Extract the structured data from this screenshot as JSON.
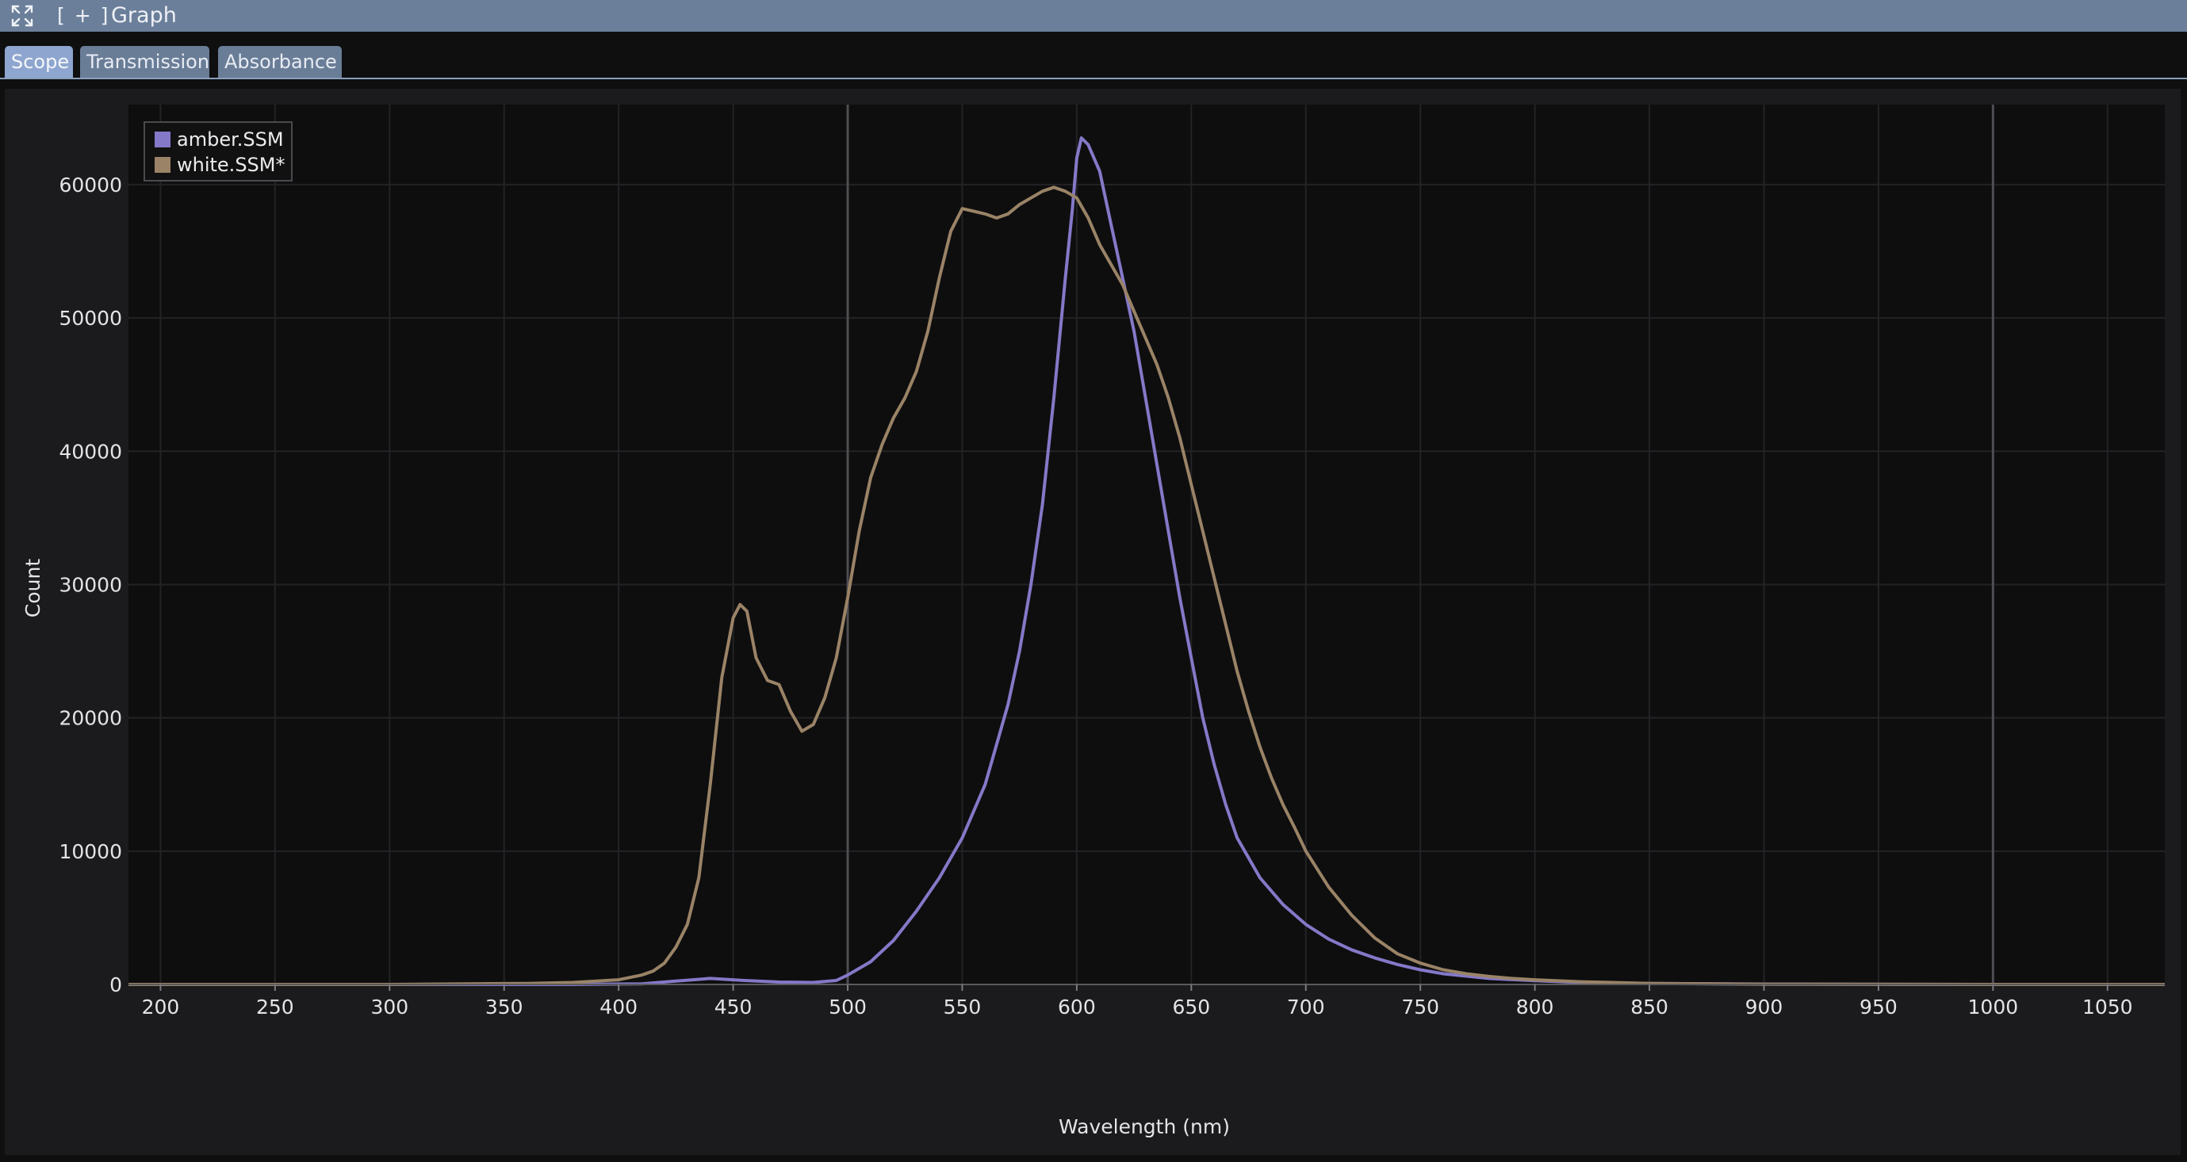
{
  "window": {
    "add_label": "[ + ]",
    "title": "Graph"
  },
  "tabs": [
    {
      "label": "Scope",
      "active": true
    },
    {
      "label": "Transmission",
      "active": false
    },
    {
      "label": "Absorbance",
      "active": false
    }
  ],
  "colors": {
    "titlebar": "#6b7f9a",
    "active_tab": "#8ea6cf",
    "plot_background": "#0e0e0f",
    "amber_series": "#8479c8",
    "white_series": "#9a8366"
  },
  "chart_data": {
    "type": "line",
    "title": "",
    "xlabel": "Wavelength (nm)",
    "ylabel": "Count",
    "xlim": [
      186,
      1075
    ],
    "ylim": [
      0,
      66000
    ],
    "xticks": [
      200,
      250,
      300,
      350,
      400,
      450,
      500,
      550,
      600,
      650,
      700,
      750,
      800,
      850,
      900,
      950,
      1000,
      1050
    ],
    "yticks": [
      0,
      10000,
      20000,
      30000,
      40000,
      50000,
      60000
    ],
    "marker_lines_x": [
      500,
      1000
    ],
    "grid": true,
    "legend_position": "top-left",
    "series": [
      {
        "name": "amber.SSM",
        "color": "#8479c8",
        "points": [
          [
            186,
            0
          ],
          [
            300,
            0
          ],
          [
            380,
            0
          ],
          [
            410,
            50
          ],
          [
            425,
            250
          ],
          [
            440,
            450
          ],
          [
            455,
            300
          ],
          [
            470,
            180
          ],
          [
            485,
            150
          ],
          [
            495,
            300
          ],
          [
            500,
            700
          ],
          [
            510,
            1700
          ],
          [
            520,
            3300
          ],
          [
            530,
            5500
          ],
          [
            540,
            8000
          ],
          [
            550,
            11000
          ],
          [
            560,
            15000
          ],
          [
            565,
            18000
          ],
          [
            570,
            21000
          ],
          [
            575,
            25000
          ],
          [
            580,
            30000
          ],
          [
            585,
            36000
          ],
          [
            590,
            44000
          ],
          [
            595,
            53000
          ],
          [
            598,
            58000
          ],
          [
            600,
            62000
          ],
          [
            602,
            63500
          ],
          [
            605,
            63000
          ],
          [
            610,
            61000
          ],
          [
            615,
            57000
          ],
          [
            620,
            53000
          ],
          [
            625,
            49000
          ],
          [
            630,
            44000
          ],
          [
            635,
            39000
          ],
          [
            640,
            34000
          ],
          [
            645,
            29000
          ],
          [
            650,
            24500
          ],
          [
            655,
            20000
          ],
          [
            660,
            16500
          ],
          [
            665,
            13500
          ],
          [
            670,
            11000
          ],
          [
            680,
            8000
          ],
          [
            690,
            6000
          ],
          [
            700,
            4500
          ],
          [
            710,
            3400
          ],
          [
            720,
            2600
          ],
          [
            730,
            2000
          ],
          [
            740,
            1500
          ],
          [
            750,
            1100
          ],
          [
            760,
            800
          ],
          [
            780,
            450
          ],
          [
            800,
            280
          ],
          [
            820,
            150
          ],
          [
            850,
            80
          ],
          [
            900,
            30
          ],
          [
            1000,
            0
          ],
          [
            1075,
            0
          ]
        ]
      },
      {
        "name": "white.SSM*",
        "color": "#9a8366",
        "points": [
          [
            186,
            0
          ],
          [
            300,
            0
          ],
          [
            360,
            80
          ],
          [
            380,
            150
          ],
          [
            400,
            350
          ],
          [
            410,
            700
          ],
          [
            415,
            1000
          ],
          [
            420,
            1600
          ],
          [
            425,
            2800
          ],
          [
            430,
            4500
          ],
          [
            435,
            8000
          ],
          [
            440,
            15000
          ],
          [
            445,
            23000
          ],
          [
            450,
            27500
          ],
          [
            453,
            28500
          ],
          [
            456,
            28000
          ],
          [
            460,
            24500
          ],
          [
            465,
            22800
          ],
          [
            470,
            22500
          ],
          [
            475,
            20500
          ],
          [
            480,
            19000
          ],
          [
            485,
            19500
          ],
          [
            490,
            21500
          ],
          [
            495,
            24500
          ],
          [
            500,
            29000
          ],
          [
            505,
            34000
          ],
          [
            510,
            38000
          ],
          [
            515,
            40500
          ],
          [
            520,
            42500
          ],
          [
            525,
            44000
          ],
          [
            530,
            46000
          ],
          [
            535,
            49000
          ],
          [
            540,
            53000
          ],
          [
            545,
            56500
          ],
          [
            550,
            58200
          ],
          [
            555,
            58000
          ],
          [
            560,
            57800
          ],
          [
            565,
            57500
          ],
          [
            570,
            57800
          ],
          [
            575,
            58500
          ],
          [
            580,
            59000
          ],
          [
            585,
            59500
          ],
          [
            590,
            59800
          ],
          [
            595,
            59500
          ],
          [
            600,
            59000
          ],
          [
            605,
            57500
          ],
          [
            610,
            55500
          ],
          [
            615,
            54000
          ],
          [
            620,
            52500
          ],
          [
            625,
            50500
          ],
          [
            630,
            48500
          ],
          [
            635,
            46500
          ],
          [
            640,
            44000
          ],
          [
            645,
            41000
          ],
          [
            650,
            37500
          ],
          [
            655,
            34000
          ],
          [
            660,
            30500
          ],
          [
            665,
            27000
          ],
          [
            670,
            23500
          ],
          [
            675,
            20500
          ],
          [
            680,
            17800
          ],
          [
            685,
            15500
          ],
          [
            690,
            13500
          ],
          [
            695,
            11800
          ],
          [
            700,
            10000
          ],
          [
            710,
            7300
          ],
          [
            720,
            5200
          ],
          [
            730,
            3500
          ],
          [
            740,
            2300
          ],
          [
            750,
            1600
          ],
          [
            760,
            1100
          ],
          [
            770,
            800
          ],
          [
            780,
            600
          ],
          [
            790,
            450
          ],
          [
            800,
            350
          ],
          [
            820,
            200
          ],
          [
            850,
            80
          ],
          [
            900,
            20
          ],
          [
            1000,
            0
          ],
          [
            1075,
            0
          ]
        ]
      }
    ]
  }
}
